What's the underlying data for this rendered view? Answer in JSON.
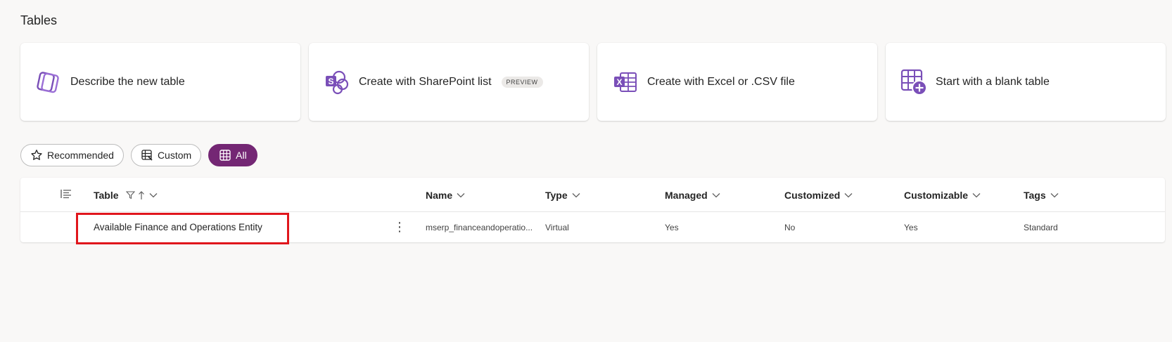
{
  "page": {
    "title": "Tables"
  },
  "cards": [
    {
      "label": "Describe the new table",
      "icon": "copilot-icon"
    },
    {
      "label": "Create with SharePoint list",
      "icon": "sharepoint-icon",
      "badge": "PREVIEW"
    },
    {
      "label": "Create with Excel or .CSV file",
      "icon": "excel-icon"
    },
    {
      "label": "Start with a blank table",
      "icon": "blank-table-add-icon"
    }
  ],
  "filters": [
    {
      "label": "Recommended",
      "icon": "star-icon",
      "active": false
    },
    {
      "label": "Custom",
      "icon": "custom-table-icon",
      "active": false
    },
    {
      "label": "All",
      "icon": "grid-icon",
      "active": true
    }
  ],
  "grid": {
    "columns": [
      "Table",
      "Name",
      "Type",
      "Managed",
      "Customized",
      "Customizable",
      "Tags"
    ],
    "rows": [
      {
        "table": "Available Finance and Operations Entity",
        "name": "mserp_financeandoperatio...",
        "type": "Virtual",
        "managed": "Yes",
        "customized": "No",
        "customizable": "Yes",
        "tags": "Standard"
      }
    ]
  },
  "colors": {
    "accent": "#742774",
    "icon_purple": "#7a4fb8",
    "highlight": "#e0161c"
  }
}
